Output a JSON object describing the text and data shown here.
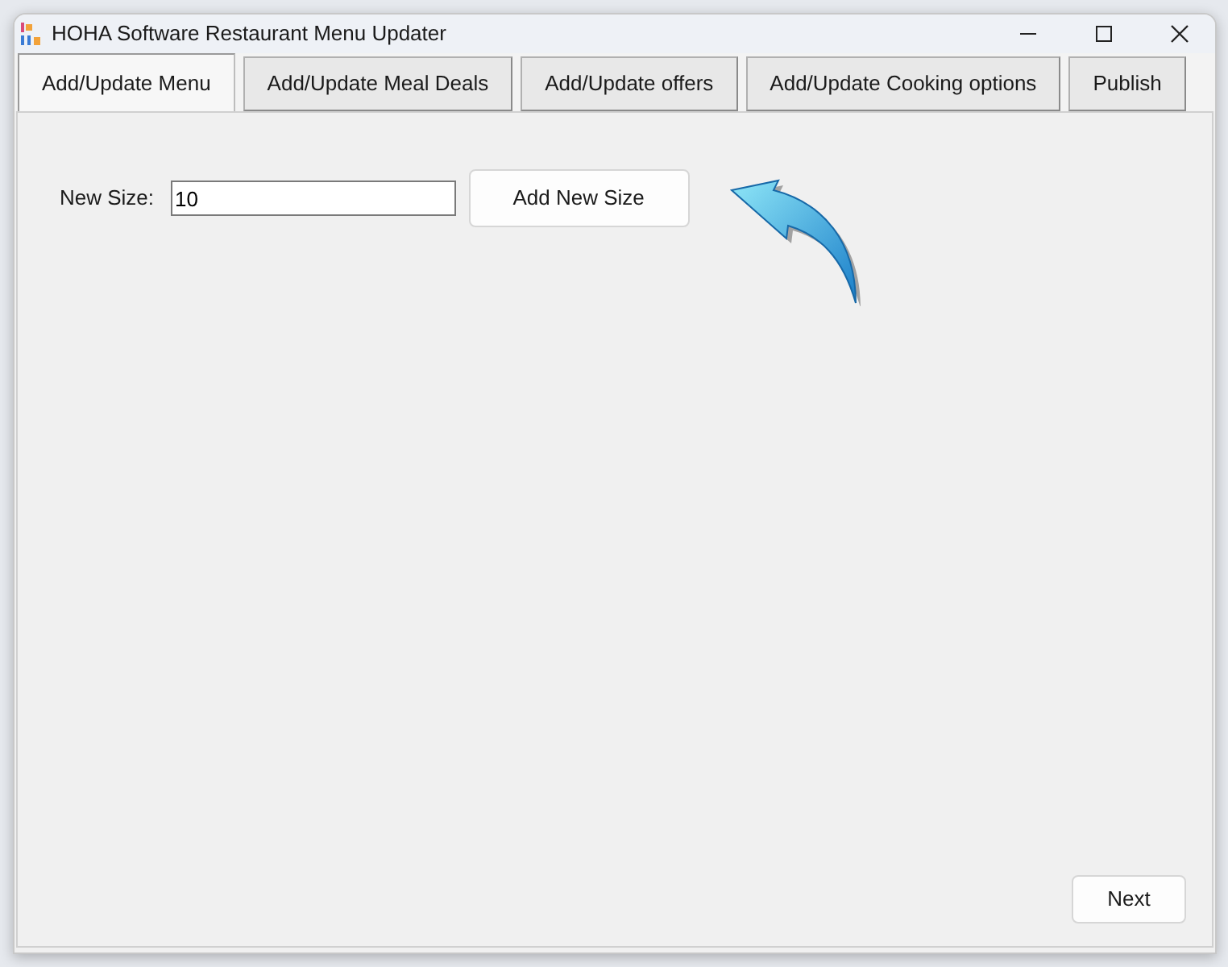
{
  "window": {
    "title": "HOHA Software Restaurant Menu Updater"
  },
  "tabs": [
    {
      "label": "Add/Update Menu",
      "selected": true
    },
    {
      "label": "Add/Update Meal Deals",
      "selected": false
    },
    {
      "label": "Add/Update offers",
      "selected": false
    },
    {
      "label": "Add/Update Cooking options",
      "selected": false
    },
    {
      "label": "Publish",
      "selected": false
    }
  ],
  "form": {
    "label": "New Size:",
    "value": "10",
    "button": "Add New Size"
  },
  "footer": {
    "button": "Next"
  }
}
